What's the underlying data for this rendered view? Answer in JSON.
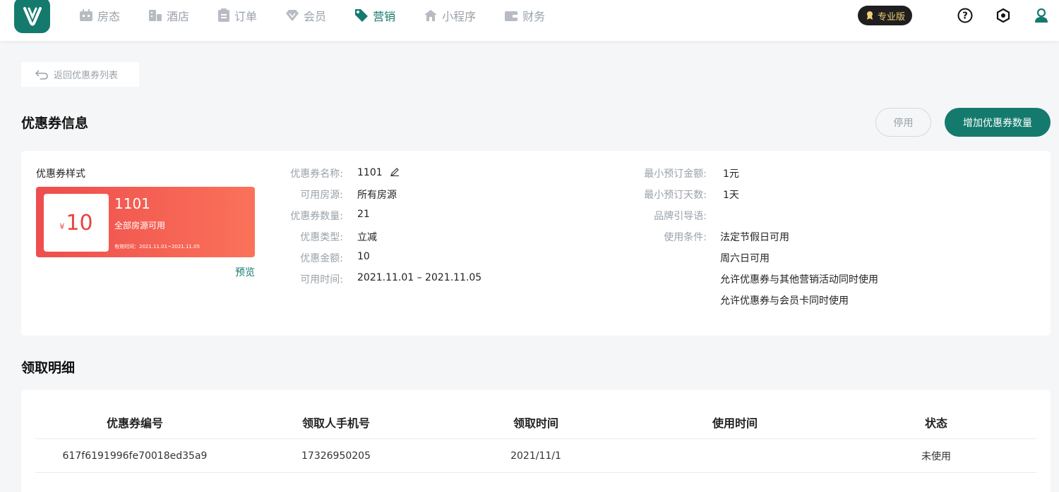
{
  "nav": {
    "items": [
      {
        "label": "房态",
        "icon": "calendar-icon"
      },
      {
        "label": "酒店",
        "icon": "building-icon"
      },
      {
        "label": "订单",
        "icon": "clipboard-icon"
      },
      {
        "label": "会员",
        "icon": "diamond-icon"
      },
      {
        "label": "营销",
        "icon": "tag-icon"
      },
      {
        "label": "小程序",
        "icon": "home-icon"
      },
      {
        "label": "财务",
        "icon": "wallet-icon"
      }
    ],
    "active_index": 4,
    "pro_badge": "专业版"
  },
  "back_button": "返回优惠券列表",
  "section_info_title": "优惠券信息",
  "actions": {
    "disable": "停用",
    "add_quantity": "增加优惠券数量"
  },
  "coupon_style": {
    "label": "优惠券样式",
    "currency": "¥",
    "amount": "10",
    "name": "1101",
    "scope": "全部房源可用",
    "validity": "有效时间：2021.11.01~2021.11.05",
    "preview": "预览"
  },
  "details_left": [
    {
      "label": "优惠券名称:",
      "value": "1101"
    },
    {
      "label": "可用房源:",
      "value": "所有房源"
    },
    {
      "label": "优惠券数量:",
      "value": "21"
    },
    {
      "label": "优惠类型:",
      "value": "立减"
    },
    {
      "label": "优惠金额:",
      "value": "10"
    },
    {
      "label": "可用时间:",
      "value": "2021.11.01 – 2021.11.05"
    }
  ],
  "details_right": [
    {
      "label": "最小预订金额:",
      "value": "1元"
    },
    {
      "label": "最小预订天数:",
      "value": "1天"
    },
    {
      "label": "品牌引导语:",
      "value": ""
    },
    {
      "label": "使用条件:",
      "value": "法定节假日可用"
    }
  ],
  "conditions_extra": [
    "周六日可用",
    "允许优惠券与其他营销活动同时使用",
    "允许优惠券与会员卡同时使用"
  ],
  "section_detail_title": "领取明细",
  "table": {
    "headers": [
      "优惠券编号",
      "领取人手机号",
      "领取时间",
      "使用时间",
      "状态"
    ],
    "rows": [
      [
        "617f6191996fe70018ed35a9",
        "17326950205",
        "2021/11/1",
        "",
        "未使用"
      ]
    ]
  },
  "colors": {
    "accent": "#157a6e",
    "coupon_start": "#ee4d4d",
    "coupon_end": "#fa7259"
  }
}
